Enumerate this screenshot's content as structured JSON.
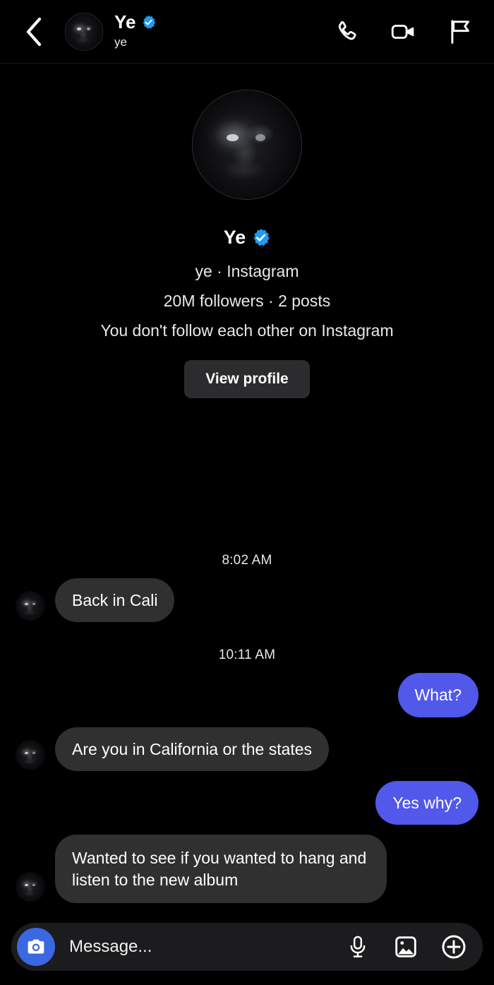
{
  "header": {
    "back_icon": "chevron-left-icon",
    "name": "Ye",
    "username": "ye",
    "verified": true,
    "actions": [
      {
        "name": "audio-call-button",
        "icon": "phone-icon"
      },
      {
        "name": "video-call-button",
        "icon": "video-camera-icon"
      },
      {
        "name": "report-button",
        "icon": "flag-icon"
      }
    ]
  },
  "profile": {
    "name": "Ye",
    "verified": true,
    "handle_line": "ye · Instagram",
    "stats_line": "20M followers · 2 posts",
    "relationship_line": "You don't follow each other on Instagram",
    "view_profile_label": "View profile"
  },
  "thread": {
    "groups": [
      {
        "timestamp": "8:02 AM",
        "messages": [
          {
            "direction": "in",
            "text": "Back in Cali",
            "avatar": true
          }
        ]
      },
      {
        "timestamp": "10:11 AM",
        "messages": [
          {
            "direction": "out",
            "text": "What?",
            "avatar": false
          },
          {
            "direction": "in",
            "text": "Are you in California or the states",
            "avatar": true
          },
          {
            "direction": "out",
            "text": "Yes why?",
            "avatar": false
          },
          {
            "direction": "in",
            "text": "Wanted to see if you wanted to hang and listen to the new album",
            "avatar": true
          }
        ]
      }
    ]
  },
  "composer": {
    "camera_icon": "camera-icon",
    "input_value": "",
    "input_placeholder": "Message...",
    "actions": [
      {
        "name": "voice-record-button",
        "icon": "microphone-icon"
      },
      {
        "name": "gallery-button",
        "icon": "image-icon"
      },
      {
        "name": "more-options-button",
        "icon": "plus-circle-icon"
      }
    ]
  },
  "colors": {
    "background": "#000000",
    "bubble_incoming": "#303030",
    "bubble_outgoing": "#5158ea",
    "camera_accent": "#3a68e0",
    "verified_blue": "#1d9bf0",
    "button_surface": "#2c2c2e",
    "composer_surface": "#1c1c1e"
  }
}
